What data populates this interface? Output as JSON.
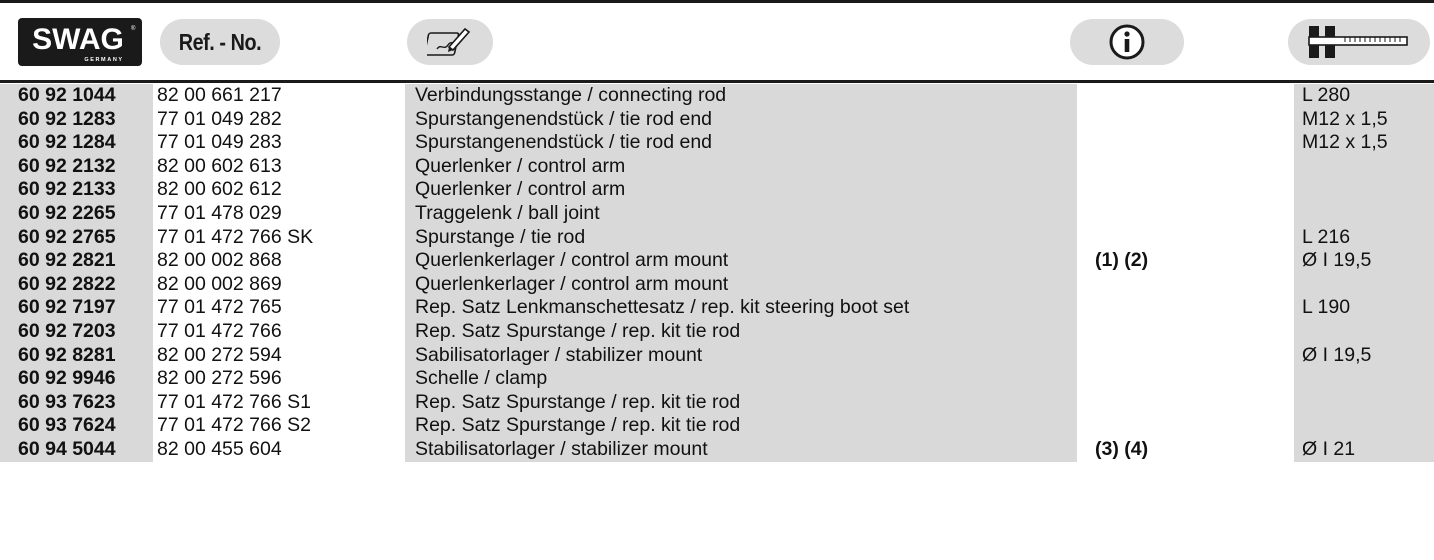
{
  "header": {
    "logo_text": "SWAG",
    "logo_sub": "GERMANY",
    "ref_label": "Ref. - No.",
    "description_icon": "pencil-writing-icon",
    "info_icon": "info-circle-icon",
    "dimension_icon": "caliper-icon"
  },
  "rows": [
    {
      "swag": "60 92 1044",
      "ref": "82 00 661 217",
      "desc": "Verbindungsstange / connecting rod",
      "info": "",
      "dim": "L 280"
    },
    {
      "swag": "60 92 1283",
      "ref": "77 01 049 282",
      "desc": "Spurstangenendstück / tie rod end",
      "info": "",
      "dim": "M12 x 1,5"
    },
    {
      "swag": "60 92 1284",
      "ref": "77 01 049 283",
      "desc": "Spurstangenendstück / tie rod end",
      "info": "",
      "dim": "M12 x 1,5"
    },
    {
      "swag": "60 92 2132",
      "ref": "82 00 602 613",
      "desc": "Querlenker / control arm",
      "info": "",
      "dim": ""
    },
    {
      "swag": "60 92 2133",
      "ref": "82 00 602 612",
      "desc": "Querlenker / control arm",
      "info": "",
      "dim": ""
    },
    {
      "swag": "60 92 2265",
      "ref": "77 01 478 029",
      "desc": "Traggelenk / ball joint",
      "info": "",
      "dim": ""
    },
    {
      "swag": "60 92 2765",
      "ref": "77 01 472 766 SK",
      "desc": "Spurstange / tie rod",
      "info": "",
      "dim": "L 216"
    },
    {
      "swag": "60 92 2821",
      "ref": "82 00 002 868",
      "desc": "Querlenkerlager / control arm mount",
      "info": "(1) (2)",
      "dim": "Ø I 19,5"
    },
    {
      "swag": "60 92 2822",
      "ref": "82 00 002 869",
      "desc": "Querlenkerlager / control arm mount",
      "info": "",
      "dim": ""
    },
    {
      "swag": "60 92 7197",
      "ref": "77 01 472 765",
      "desc": "Rep. Satz Lenkmanschettesatz / rep. kit steering boot set",
      "info": "",
      "dim": "L 190"
    },
    {
      "swag": "60 92 7203",
      "ref": "77 01 472 766",
      "desc": "Rep. Satz Spurstange / rep. kit tie rod",
      "info": "",
      "dim": ""
    },
    {
      "swag": "60 92 8281",
      "ref": "82 00 272 594",
      "desc": "Sabilisatorlager / stabilizer mount",
      "info": "",
      "dim": "Ø I 19,5"
    },
    {
      "swag": "60 92 9946",
      "ref": "82 00 272 596",
      "desc": "Schelle / clamp",
      "info": "",
      "dim": ""
    },
    {
      "swag": "60 93 7623",
      "ref": "77 01 472 766 S1",
      "desc": "Rep. Satz Spurstange / rep. kit tie rod",
      "info": "",
      "dim": ""
    },
    {
      "swag": "60 93 7624",
      "ref": "77 01 472 766 S2",
      "desc": "Rep. Satz Spurstange / rep. kit tie rod",
      "info": "",
      "dim": ""
    },
    {
      "swag": "60 94 5044",
      "ref": "82 00 455 604",
      "desc": "Stabilisatorlager / stabilizer mount",
      "info": "(3) (4)",
      "dim": "Ø I 21"
    }
  ]
}
